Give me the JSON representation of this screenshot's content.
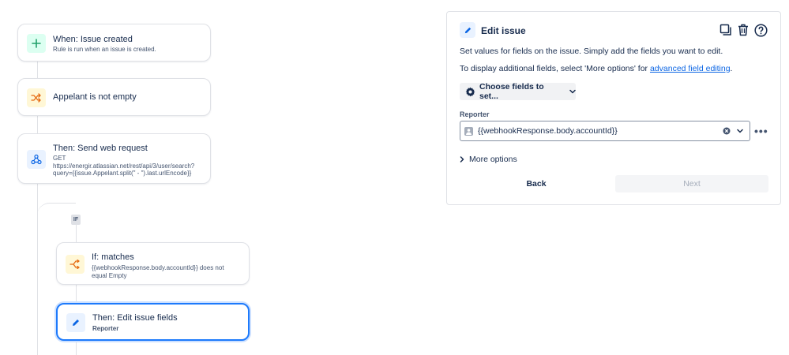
{
  "flow": {
    "trigger": {
      "title": "When: Issue created",
      "subtitle": "Rule is run when an issue is created."
    },
    "condition": {
      "title": "Appelant is not empty"
    },
    "web_request": {
      "title": "Then: Send web request",
      "method": "GET",
      "url_line1": "https://energir.atlassian.net/rest/api/3/user/search?",
      "url_line2": "query={{issue.Appelant.split(\" - \").last.urlEncode}}"
    },
    "if_badge": "IF",
    "if_matches": {
      "title": "If: matches",
      "subtitle_line1": "{{webhookResponse.body.accountId}} does not",
      "subtitle_line2": "equal Empty"
    },
    "edit_fields": {
      "title": "Then: Edit issue fields",
      "subtitle": "Reporter"
    }
  },
  "panel": {
    "title": "Edit issue",
    "description": "Set values for fields on the issue. Simply add the fields you want to edit.",
    "additional_prefix": "To display additional fields, select 'More options' for ",
    "additional_link": "advanced field editing",
    "additional_suffix": ".",
    "choose_fields_label": "Choose fields to set...",
    "reporter_label": "Reporter",
    "reporter_value": "{{webhookResponse.body.accountId}}",
    "more_options_label": "More options",
    "back_label": "Back",
    "next_label": "Next"
  },
  "colors": {
    "accent": "#1d7afc",
    "link": "#0c66e4",
    "trigger_icon_bg": "#dcfff1",
    "trigger_icon": "#22a06b",
    "condition_icon_bg": "#fff7d6",
    "condition_icon": "#e56910",
    "action_icon_bg": "#e9f2ff",
    "action_icon": "#0c66e4"
  }
}
